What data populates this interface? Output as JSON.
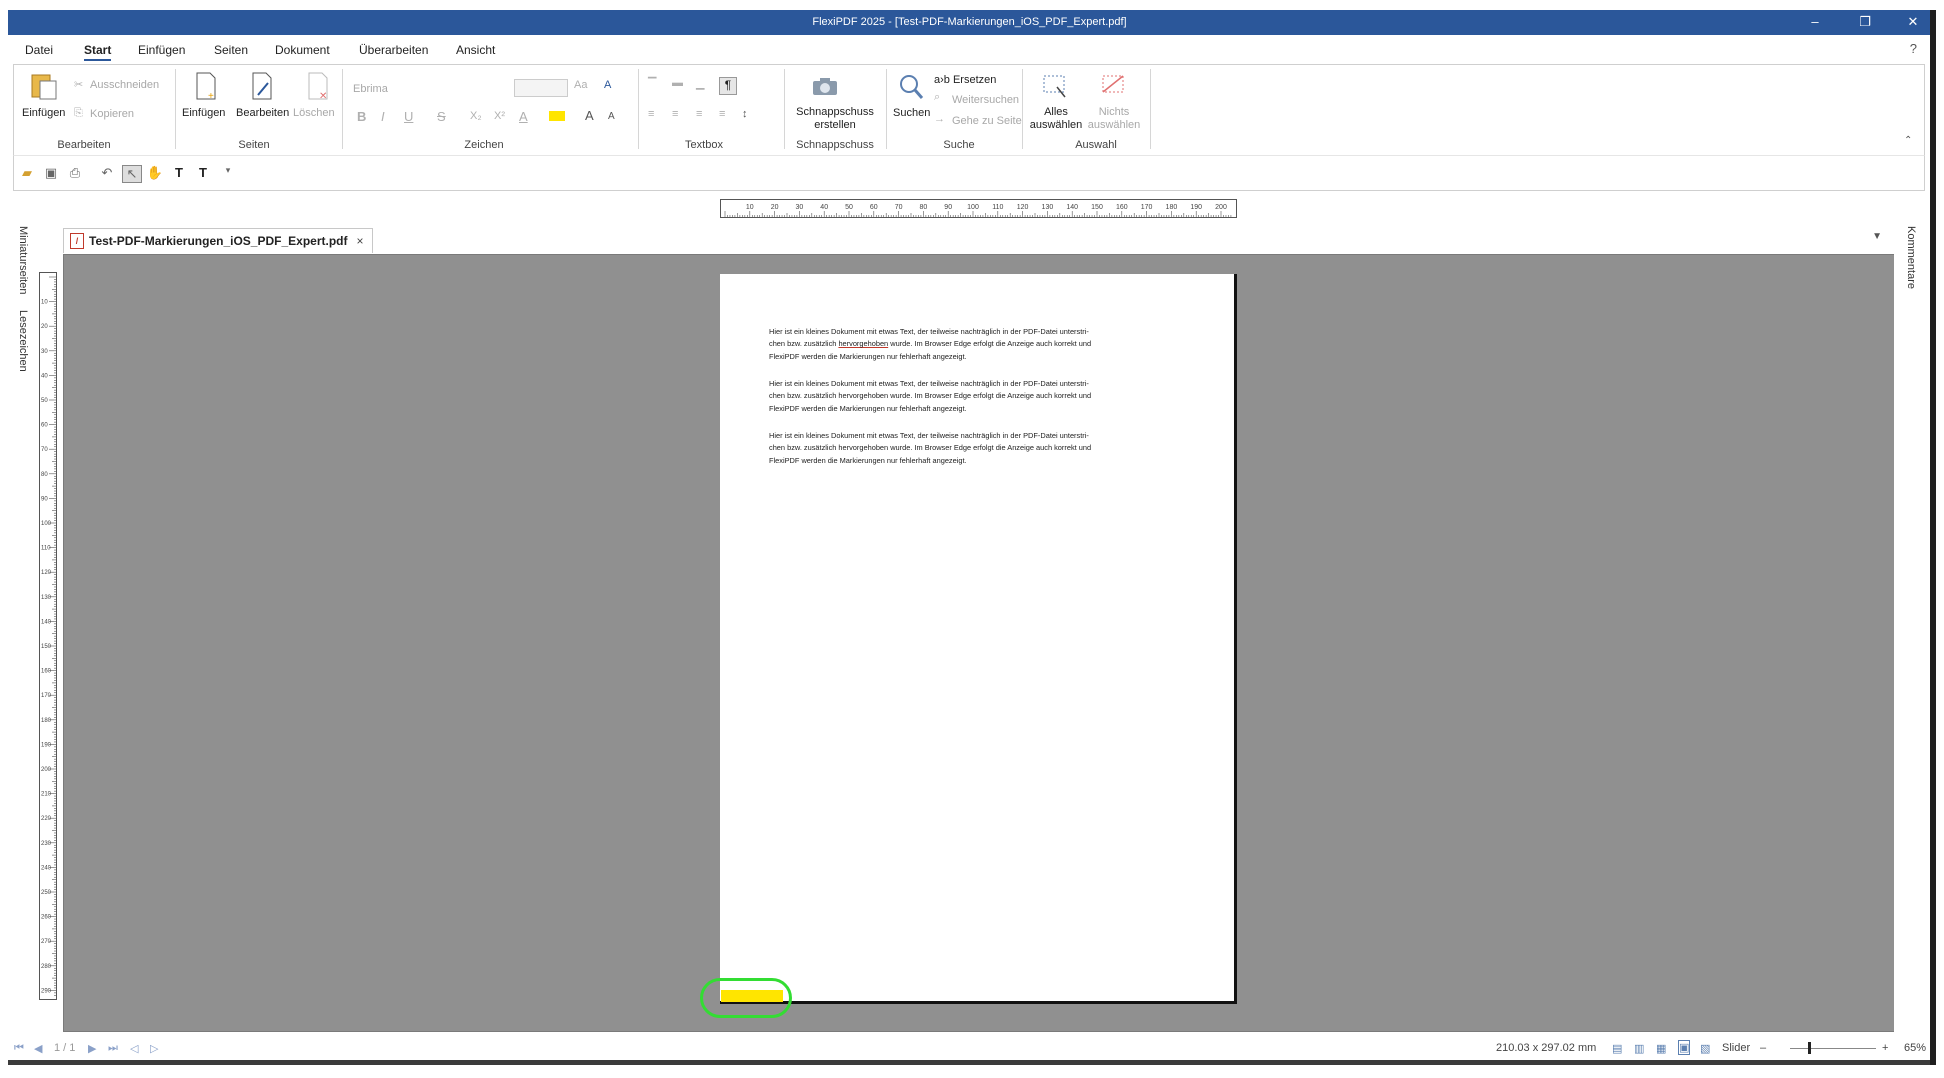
{
  "window": {
    "title": "FlexiPDF 2025 - [Test-PDF-Markierungen_iOS_PDF_Expert.pdf]",
    "minimize": "–",
    "restore": "❐",
    "close": "✕"
  },
  "menu": {
    "items": [
      "Datei",
      "Start",
      "Einfügen",
      "Seiten",
      "Dokument",
      "Überarbeiten",
      "Ansicht"
    ],
    "active": "Start",
    "help": "?"
  },
  "ribbon": {
    "bearbeiten": {
      "label": "Bearbeiten",
      "einfuegen": "Einfügen",
      "ausschneiden": "Ausschneiden",
      "kopieren": "Kopieren"
    },
    "seiten": {
      "label": "Seiten",
      "einfuegen": "Einfügen",
      "bearbeiten": "Bearbeiten",
      "loeschen": "Löschen"
    },
    "zeichen": {
      "label": "Zeichen",
      "font": "Ebrima",
      "bold": "B",
      "italic": "I",
      "underline": "U",
      "strike": "S",
      "subscript": "X₂",
      "superscript": "X²",
      "grow": "A",
      "shrink": "A"
    },
    "textbox": {
      "label": "Textbox"
    },
    "schnappschuss": {
      "label": "Schnappschuss",
      "button_line1": "Schnappschuss",
      "button_line2": "erstellen"
    },
    "suche": {
      "label": "Suche",
      "suchen": "Suchen",
      "ersetzen": "a›b Ersetzen",
      "weitersuchen": "Weitersuchen",
      "gehe_zu_seite": "Gehe zu Seite"
    },
    "auswahl": {
      "label": "Auswahl",
      "alles_line1": "Alles",
      "alles_line2": "auswählen",
      "nichts_line1": "Nichts",
      "nichts_line2": "auswählen"
    }
  },
  "side_tabs": {
    "left": [
      "Miniaturseiten",
      "Lesezeichen"
    ],
    "right": "Kommentare"
  },
  "document_tab": {
    "filename": "Test-PDF-Markierungen_iOS_PDF_Expert.pdf",
    "close": "×"
  },
  "page": {
    "paragraphs": [
      {
        "line1": "Hier ist ein kleines Dokument mit etwas Text, der teilweise nachträglich in der PDF-Datei unterstri-",
        "line2_a": "chen bzw. zusätzlich ",
        "line2_u": "hervorgehoben",
        "line2_b": " wurde. Im Browser Edge erfolgt die Anzeige auch korrekt und",
        "line3": "FlexiPDF werden die Markierungen nur fehlerhaft angezeigt."
      },
      {
        "line1": "Hier ist ein kleines Dokument mit etwas Text, der teilweise nachträglich in der PDF-Datei unterstri-",
        "line2": "chen bzw. zusätzlich hervorgehoben wurde. Im Browser Edge erfolgt die Anzeige auch korrekt und",
        "line3": "FlexiPDF werden die Markierungen nur fehlerhaft angezeigt."
      },
      {
        "line1": "Hier ist ein kleines Dokument mit etwas Text, der teilweise nachträglich in der PDF-Datei unterstri-",
        "line2": "chen bzw. zusätzlich hervorgehoben wurde. Im Browser Edge erfolgt die Anzeige auch korrekt und",
        "line3": "FlexiPDF werden die Markierungen nur fehlerhaft angezeigt."
      }
    ]
  },
  "rulers": {
    "horizontal_ticks": [
      "10",
      "20",
      "30",
      "40",
      "50",
      "60",
      "70",
      "80",
      "90",
      "100",
      "110",
      "120",
      "130",
      "140",
      "150",
      "160",
      "170",
      "180",
      "190",
      "200"
    ],
    "vertical_ticks": [
      "10",
      "20",
      "30",
      "40",
      "50",
      "60",
      "70",
      "80",
      "90",
      "100",
      "110",
      "120",
      "130",
      "140",
      "150",
      "160",
      "170",
      "180",
      "190",
      "200",
      "210",
      "220",
      "230",
      "240",
      "250",
      "260",
      "270",
      "280",
      "290"
    ]
  },
  "status": {
    "page_indicator": "1 / 1",
    "dimensions": "210.03 x 297.02 mm",
    "zoom_mode": "Slider",
    "zoom_minus": "–",
    "zoom_plus": "+",
    "zoom": "65%"
  },
  "colors": {
    "titlebar": "#2b579a",
    "canvas": "#909090",
    "highlight": "#ffe500",
    "annotation_circle": "#33dd33",
    "underline": "#c0392b"
  }
}
